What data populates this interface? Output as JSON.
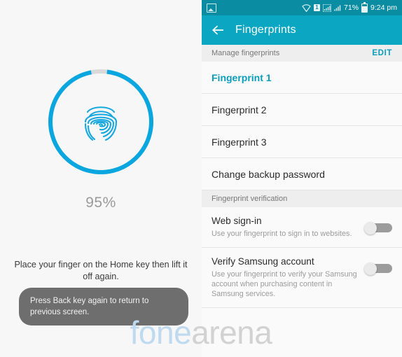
{
  "left": {
    "progress_percent": 95,
    "progress_label": "95%",
    "ring_color": "#0aa6e0",
    "ring_gap_color": "#d9d9d9",
    "fingerprint_icon": "fingerprint-icon",
    "instruction": "Place your finger on the Home key then lift it off again.",
    "toast": "Press Back key again to return to previous screen."
  },
  "right": {
    "status_bar": {
      "gallery_icon": "gallery-icon",
      "wifi_icon": "wifi-icon",
      "sim_icon": "sim-1-icon",
      "signal_icon": "signal-bars-icon",
      "signal_icon_2": "signal-bars-icon",
      "battery_percent": "71%",
      "battery_icon": "battery-icon",
      "clock": "9:24 pm",
      "background": "#0a8ca3"
    },
    "app_bar": {
      "back_icon": "back-arrow-icon",
      "title": "Fingerprints",
      "background": "#0aa6c2"
    },
    "manage_section": {
      "header": "Manage fingerprints",
      "action": "EDIT",
      "action_color": "#0a9dba",
      "items": [
        {
          "label": "Fingerprint 1",
          "active": true
        },
        {
          "label": "Fingerprint 2",
          "active": false
        },
        {
          "label": "Fingerprint 3",
          "active": false
        },
        {
          "label": "Change backup password",
          "active": false
        }
      ]
    },
    "verification_section": {
      "header": "Fingerprint verification",
      "items": [
        {
          "title": "Web sign-in",
          "desc": "Use your fingerprint to sign in to websites.",
          "toggle_on": false
        },
        {
          "title": "Verify Samsung account",
          "desc": "Use your fingerprint to verify your Samsung account when purchasing content in Samsung services.",
          "toggle_on": false
        }
      ]
    }
  },
  "watermark": {
    "part1": "fone",
    "part2": "arena",
    "color1": "#bfd9ef",
    "color2": "#d2d2d2"
  }
}
